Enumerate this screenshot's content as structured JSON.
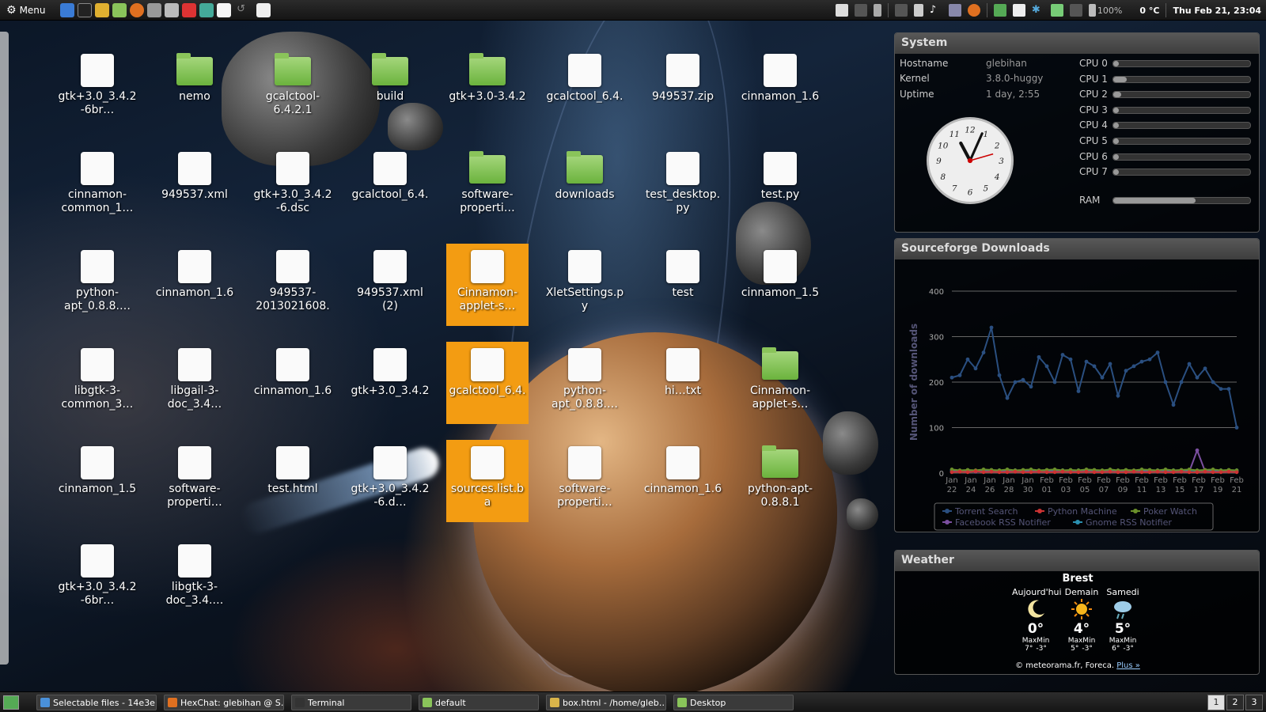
{
  "top_panel": {
    "menu_label": "Menu",
    "temperature": "0 °C",
    "battery": "100%",
    "datetime": "Thu Feb 21, 23:04"
  },
  "desktop_icons": [
    {
      "label": "gtk+3.0_3.4.2-6br…",
      "type": "file",
      "selected": false
    },
    {
      "label": "nemo",
      "type": "folder",
      "selected": false
    },
    {
      "label": "gcalctool-6.4.2.1",
      "type": "folder",
      "selected": false
    },
    {
      "label": "build",
      "type": "folder",
      "selected": false
    },
    {
      "label": "gtk+3.0-3.4.2",
      "type": "folder",
      "selected": false
    },
    {
      "label": "gcalctool_6.4.",
      "type": "file",
      "selected": false
    },
    {
      "label": "949537.zip",
      "type": "file",
      "selected": false
    },
    {
      "label": "cinnamon_1.6",
      "type": "file",
      "selected": false
    },
    {
      "label": "cinnamon-common_1…",
      "type": "file",
      "selected": false
    },
    {
      "label": "949537.xml",
      "type": "file",
      "selected": false
    },
    {
      "label": "gtk+3.0_3.4.2-6.dsc",
      "type": "file",
      "selected": false
    },
    {
      "label": "gcalctool_6.4.",
      "type": "file",
      "selected": false
    },
    {
      "label": "software-properti…",
      "type": "folder",
      "selected": false
    },
    {
      "label": "downloads",
      "type": "folder",
      "selected": false
    },
    {
      "label": "test_desktop.py",
      "type": "file",
      "selected": false
    },
    {
      "label": "test.py",
      "type": "file",
      "selected": false
    },
    {
      "label": "python-apt_0.8.8.…",
      "type": "file",
      "selected": false
    },
    {
      "label": "cinnamon_1.6",
      "type": "file",
      "selected": false
    },
    {
      "label": "949537-2013021608.",
      "type": "file",
      "selected": false
    },
    {
      "label": "949537.xml (2)",
      "type": "file",
      "selected": false
    },
    {
      "label": "Cinnamon-applet-s…",
      "type": "file",
      "selected": true
    },
    {
      "label": "XletSettings.py",
      "type": "file",
      "selected": false
    },
    {
      "label": "test",
      "type": "file",
      "selected": false
    },
    {
      "label": "cinnamon_1.5",
      "type": "file",
      "selected": false
    },
    {
      "label": "libgtk-3-common_3…",
      "type": "file",
      "selected": false
    },
    {
      "label": "libgail-3-doc_3.4…",
      "type": "file",
      "selected": false
    },
    {
      "label": "cinnamon_1.6",
      "type": "file",
      "selected": false
    },
    {
      "label": "gtk+3.0_3.4.2",
      "type": "file",
      "selected": false
    },
    {
      "label": "gcalctool_6.4.",
      "type": "file",
      "selected": true
    },
    {
      "label": "python-apt_0.8.8.…",
      "type": "file",
      "selected": false
    },
    {
      "label": "hi…txt",
      "type": "file",
      "selected": false
    },
    {
      "label": "Cinnamon-applet-s…",
      "type": "folder",
      "selected": false
    },
    {
      "label": "cinnamon_1.5",
      "type": "file",
      "selected": false
    },
    {
      "label": "software-properti…",
      "type": "file",
      "selected": false
    },
    {
      "label": "test.html",
      "type": "file",
      "selected": false
    },
    {
      "label": "gtk+3.0_3.4.2-6.d…",
      "type": "file",
      "selected": false
    },
    {
      "label": "sources.list.ba",
      "type": "file",
      "selected": true
    },
    {
      "label": "software-properti…",
      "type": "file",
      "selected": false
    },
    {
      "label": "cinnamon_1.6",
      "type": "file",
      "selected": false
    },
    {
      "label": "python-apt-0.8.8.1",
      "type": "folder",
      "selected": false
    },
    {
      "label": "gtk+3.0_3.4.2-6br…",
      "type": "file",
      "selected": false
    },
    {
      "label": "libgtk-3-doc_3.4.…",
      "type": "file",
      "selected": false
    }
  ],
  "system": {
    "title": "System",
    "rows": [
      {
        "key": "Hostname",
        "value": "glebihan"
      },
      {
        "key": "Kernel",
        "value": "3.8.0-huggy"
      },
      {
        "key": "Uptime",
        "value": "1 day, 2:55"
      }
    ],
    "cpus": [
      {
        "label": "CPU 0",
        "usage": 0.04
      },
      {
        "label": "CPU 1",
        "usage": 0.1
      },
      {
        "label": "CPU 2",
        "usage": 0.06
      },
      {
        "label": "CPU 3",
        "usage": 0.03
      },
      {
        "label": "CPU 4",
        "usage": 0.03
      },
      {
        "label": "CPU 5",
        "usage": 0.03
      },
      {
        "label": "CPU 6",
        "usage": 0.03
      },
      {
        "label": "CPU 7",
        "usage": 0.03
      }
    ],
    "ram_label": "RAM",
    "ram_usage": 0.6,
    "clock": {
      "hour": 11,
      "minute": 4
    }
  },
  "sourceforge": {
    "title": "Sourceforge Downloads"
  },
  "chart_data": {
    "type": "line",
    "title": "",
    "ylabel": "Number of downloads",
    "xlabel": "",
    "ylim": [
      0,
      400
    ],
    "yticks": [
      0,
      100,
      200,
      300,
      400
    ],
    "grid": true,
    "legend_position": "bottom",
    "x_tick_labels": [
      [
        "Jan",
        "22"
      ],
      [
        "Jan",
        "24"
      ],
      [
        "Jan",
        "26"
      ],
      [
        "Jan",
        "28"
      ],
      [
        "Jan",
        "30"
      ],
      [
        "Feb",
        "01"
      ],
      [
        "Feb",
        "03"
      ],
      [
        "Feb",
        "05"
      ],
      [
        "Feb",
        "07"
      ],
      [
        "Feb",
        "09"
      ],
      [
        "Feb",
        "11"
      ],
      [
        "Feb",
        "13"
      ],
      [
        "Feb",
        "15"
      ],
      [
        "Feb",
        "17"
      ],
      [
        "Feb",
        "19"
      ],
      [
        "Feb",
        "21"
      ]
    ],
    "series": [
      {
        "name": "Torrent Search",
        "color": "#2a4f80",
        "values": [
          210,
          215,
          250,
          230,
          265,
          320,
          215,
          165,
          200,
          205,
          190,
          255,
          235,
          200,
          260,
          250,
          180,
          245,
          235,
          210,
          240,
          170,
          225,
          235,
          245,
          250,
          265,
          200,
          150,
          200,
          240,
          210,
          230,
          200,
          185,
          185,
          100
        ]
      },
      {
        "name": "Python Machine",
        "color": "#cc3333",
        "values": [
          2,
          3,
          2,
          4,
          2,
          3,
          2,
          2,
          3,
          2,
          2,
          3,
          2,
          2,
          3,
          2,
          2,
          3,
          2,
          2,
          3,
          2,
          2,
          3,
          2,
          2,
          3,
          2,
          2,
          3,
          2,
          2,
          3,
          2,
          2,
          3,
          2
        ]
      },
      {
        "name": "Poker Watch",
        "color": "#6a8f2a",
        "values": [
          8,
          6,
          7,
          6,
          8,
          7,
          6,
          8,
          6,
          7,
          8,
          6,
          7,
          8,
          6,
          7,
          6,
          8,
          7,
          6,
          8,
          6,
          7,
          6,
          8,
          7,
          6,
          8,
          6,
          7,
          8,
          6,
          7,
          8,
          6,
          7,
          6
        ]
      },
      {
        "name": "Facebook RSS Notifier",
        "color": "#7b4fa0",
        "values": [
          3,
          4,
          3,
          3,
          4,
          3,
          3,
          4,
          3,
          3,
          4,
          3,
          3,
          4,
          3,
          3,
          4,
          3,
          3,
          4,
          3,
          3,
          4,
          3,
          3,
          4,
          3,
          3,
          4,
          3,
          3,
          50,
          4,
          3,
          3,
          4,
          3
        ]
      },
      {
        "name": "Gnome RSS Notifier",
        "color": "#2a8fb0",
        "values": [
          6,
          5,
          6,
          5,
          6,
          5,
          6,
          5,
          6,
          5,
          6,
          5,
          6,
          5,
          6,
          5,
          6,
          5,
          6,
          5,
          6,
          5,
          6,
          5,
          6,
          5,
          6,
          5,
          6,
          5,
          6,
          5,
          6,
          5,
          6,
          5,
          6
        ]
      }
    ]
  },
  "weather": {
    "title": "Weather",
    "city": "Brest",
    "days": [
      {
        "name": "Aujourd'hui",
        "icon": "moon-icon",
        "temp": "0°",
        "maxmin_label": "MaxMin",
        "max": "7°",
        "min": "-3°"
      },
      {
        "name": "Demain",
        "icon": "sun-icon",
        "temp": "4°",
        "maxmin_label": "MaxMin",
        "max": "5°",
        "min": "-3°"
      },
      {
        "name": "Samedi",
        "icon": "rain-cloud-icon",
        "temp": "5°",
        "maxmin_label": "MaxMin",
        "max": "6°",
        "min": "-3°"
      }
    ],
    "credit": "© meteorama.fr, Foreca.",
    "more_link": "Plus »"
  },
  "taskbar": {
    "tasks": [
      {
        "label": "Selectable files - 14e3e…",
        "icon_color": "#4a90d9"
      },
      {
        "label": "HexChat: glebihan @ S…",
        "icon_color": "#e07020"
      },
      {
        "label": "Terminal",
        "icon_color": "#333333"
      },
      {
        "label": "default",
        "icon_color": "#8ac45a"
      },
      {
        "label": "box.html - /home/gleb…",
        "icon_color": "#d9b44a"
      },
      {
        "label": "Desktop",
        "icon_color": "#8ac45a"
      }
    ],
    "workspaces": [
      "1",
      "2",
      "3"
    ]
  }
}
